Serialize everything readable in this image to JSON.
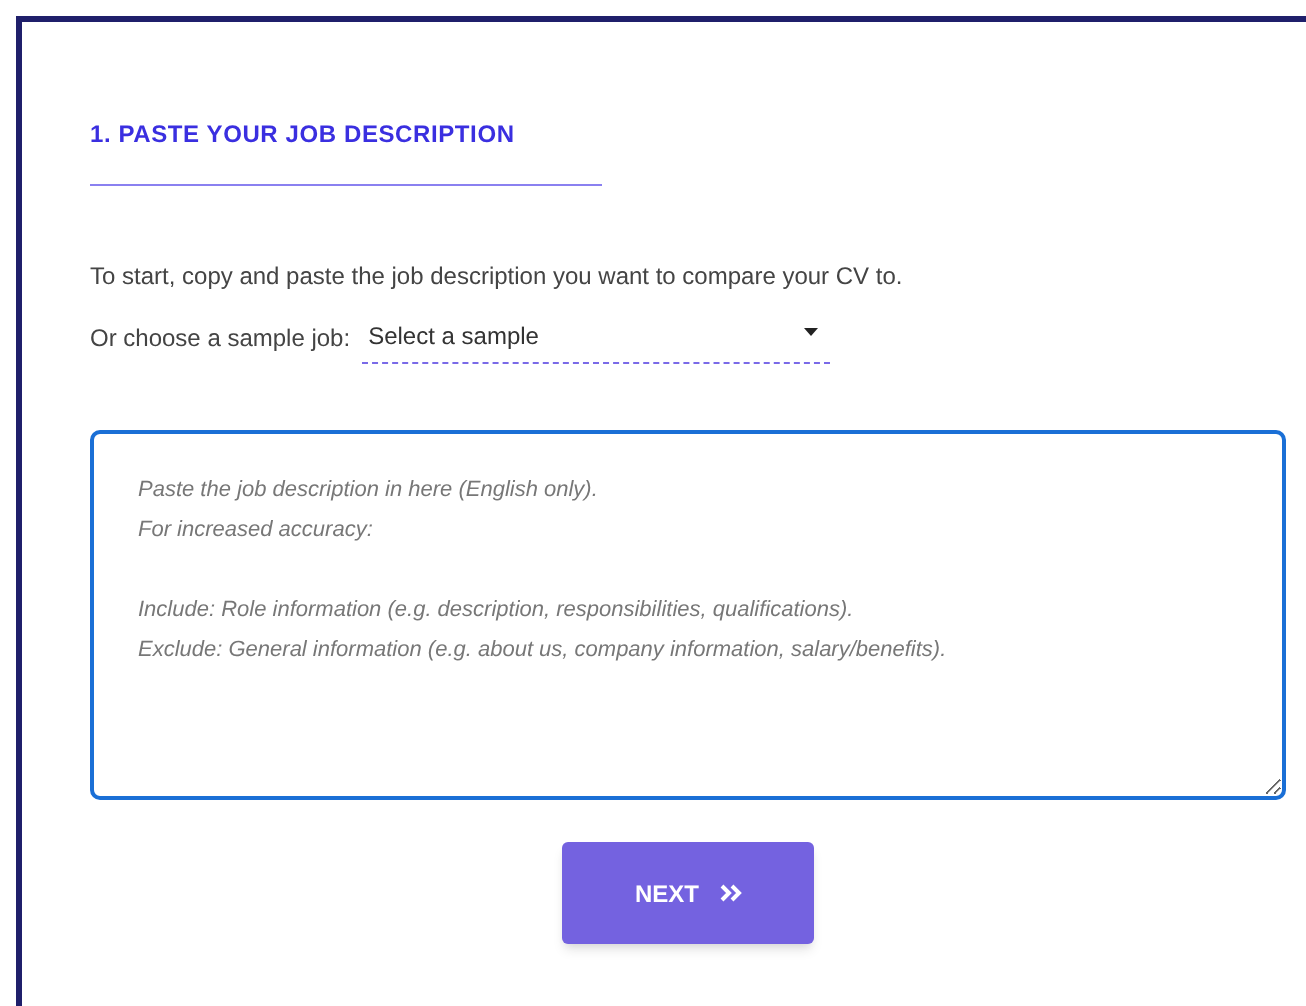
{
  "heading": "1. PASTE YOUR JOB DESCRIPTION",
  "intro": "To start, copy and paste the job description you want to compare your CV to.",
  "sample": {
    "label": "Or choose a sample job:",
    "value": "Select a sample"
  },
  "job_description": {
    "placeholder": "Paste the job description in here (English only).\nFor increased accuracy:\n\nInclude: Role information (e.g. description, responsibilities, qualifications).\nExclude: General information (e.g. about us, company information, salary/benefits).",
    "focused": true
  },
  "next_button": {
    "label": "NEXT"
  }
}
